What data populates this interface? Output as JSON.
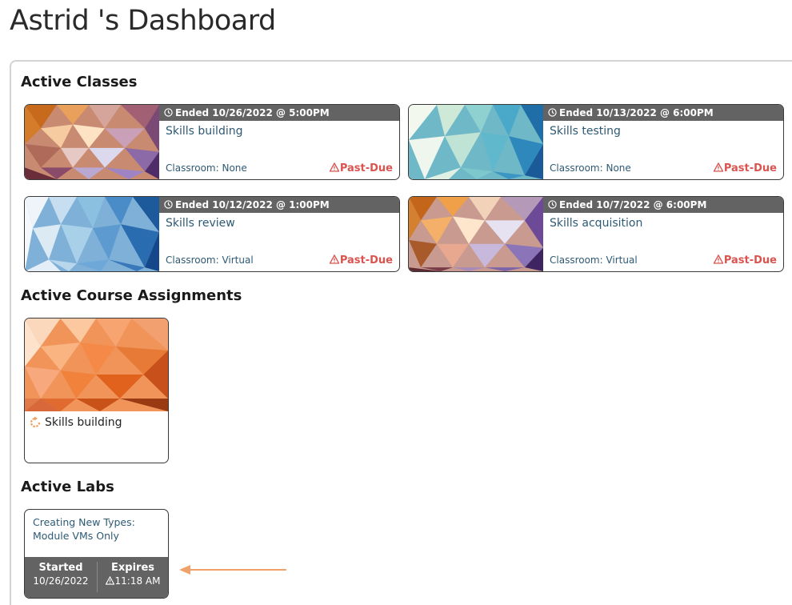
{
  "page": {
    "title": "Astrid 's Dashboard"
  },
  "sections": {
    "classes_title": "Active Classes",
    "courses_title": "Active Course Assignments",
    "labs_title": "Active Labs"
  },
  "classes": [
    {
      "ended": "Ended 10/26/2022 @ 5:00PM",
      "title": "Skills building",
      "classroom": "Classroom: None",
      "status": "Past-Due"
    },
    {
      "ended": "Ended 10/13/2022 @ 6:00PM",
      "title": "Skills testing",
      "classroom": "Classroom: None",
      "status": "Past-Due"
    },
    {
      "ended": "Ended 10/12/2022 @ 1:00PM",
      "title": "Skills review",
      "classroom": "Classroom: Virtual",
      "status": "Past-Due"
    },
    {
      "ended": "Ended 10/7/2022 @ 6:00PM",
      "title": "Skills acquisition",
      "classroom": "Classroom: Virtual",
      "status": "Past-Due"
    }
  ],
  "courses": [
    {
      "title": "Skills building"
    }
  ],
  "labs": [
    {
      "title": "Creating New Types: Module VMs Only",
      "started_label": "Started",
      "started_value": "10/26/2022",
      "expires_label": "Expires",
      "expires_value": "11:18 AM"
    }
  ],
  "colors": {
    "status_red": "#d9534f",
    "link_blue": "#2e5a74",
    "bar_gray": "#636363",
    "arrow_orange": "#f0a26a"
  }
}
